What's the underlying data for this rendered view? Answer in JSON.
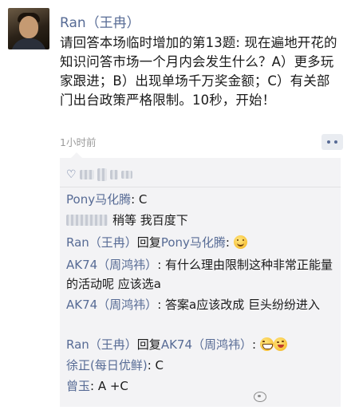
{
  "post": {
    "username": "Ran（王冉）",
    "text": "请回答本场临时增加的第13题: 现在遍地开花的知识问答市场一个月内会发生什么？A）更多玩家跟进；B）出现单场千万奖金额；C）有关部门出台政策严格限制。10秒，开始！",
    "time": "1小时前"
  },
  "comments": [
    {
      "name": "Pony马化腾",
      "text": ": C"
    },
    {
      "name": "",
      "text": "稍等 我百度下"
    },
    {
      "name": "Ran（王冉）",
      "mid": "回复",
      "target": "Pony马化腾",
      "text": ":",
      "emoji": [
        "smile-emoji"
      ]
    },
    {
      "name": "AK74（周鸿祎）",
      "text": ": 有什么理由限制这种非常正能量的活动呢 应该选a"
    },
    {
      "name": "AK74（周鸿祎）",
      "text": ": 答案a应该改成 巨头纷纷进入"
    },
    {
      "name": "Ran（王冉）",
      "mid": "回复",
      "target": "AK74（周鸿祎）",
      "text": ":",
      "emoji": [
        "grin-emoji",
        "wink-emoji"
      ]
    },
    {
      "name": "徐正(每日优鲜)",
      "text": ": C"
    },
    {
      "name": "曾玉",
      "text": ": A +C"
    }
  ],
  "icons": {
    "comment_button": "more-dots-icon",
    "likes": "heart-icon"
  },
  "colors": {
    "name_link": "#576b95",
    "comment_bg": "#f3f3f5",
    "time": "#9b9b9b"
  }
}
